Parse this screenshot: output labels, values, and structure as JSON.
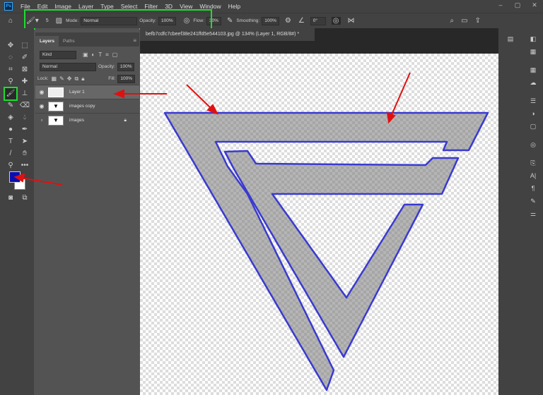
{
  "menu": {
    "logo": "Ps",
    "items": [
      "File",
      "Edit",
      "Image",
      "Layer",
      "Type",
      "Select",
      "Filter",
      "3D",
      "View",
      "Window",
      "Help"
    ]
  },
  "options": {
    "brush_size": "5",
    "mode_label": "Mode:",
    "mode_value": "Normal",
    "opacity_label": "Opacity:",
    "opacity_value": "100%",
    "flow_label": "Flow:",
    "flow_value": "30%",
    "smoothing_label": "Smoothing:",
    "smoothing_value": "100%",
    "angle_value": "0°"
  },
  "document": {
    "tab_title": "befb7cdfc7cbeef38e241ffd5e544103.jpg @ 134% (Layer 1, RGB/8#) *"
  },
  "layers_panel": {
    "tabs": [
      "Layers",
      "Paths"
    ],
    "filter": "Kind",
    "blend": "Normal",
    "opacity_label": "Opacity:",
    "opacity": "100%",
    "lock_label": "Lock:",
    "fill_label": "Fill:",
    "fill": "100%",
    "layers": [
      {
        "name": "Layer 1",
        "visible": true,
        "selected": true
      },
      {
        "name": "images copy",
        "visible": true
      },
      {
        "name": "images",
        "visible": false,
        "locked": true
      }
    ]
  },
  "colors": {
    "foreground": "#0a0fb0",
    "background": "#ffffff",
    "highlight": "#1fdc2f",
    "arrow": "#e01010",
    "outline": "#3a3ad0"
  }
}
